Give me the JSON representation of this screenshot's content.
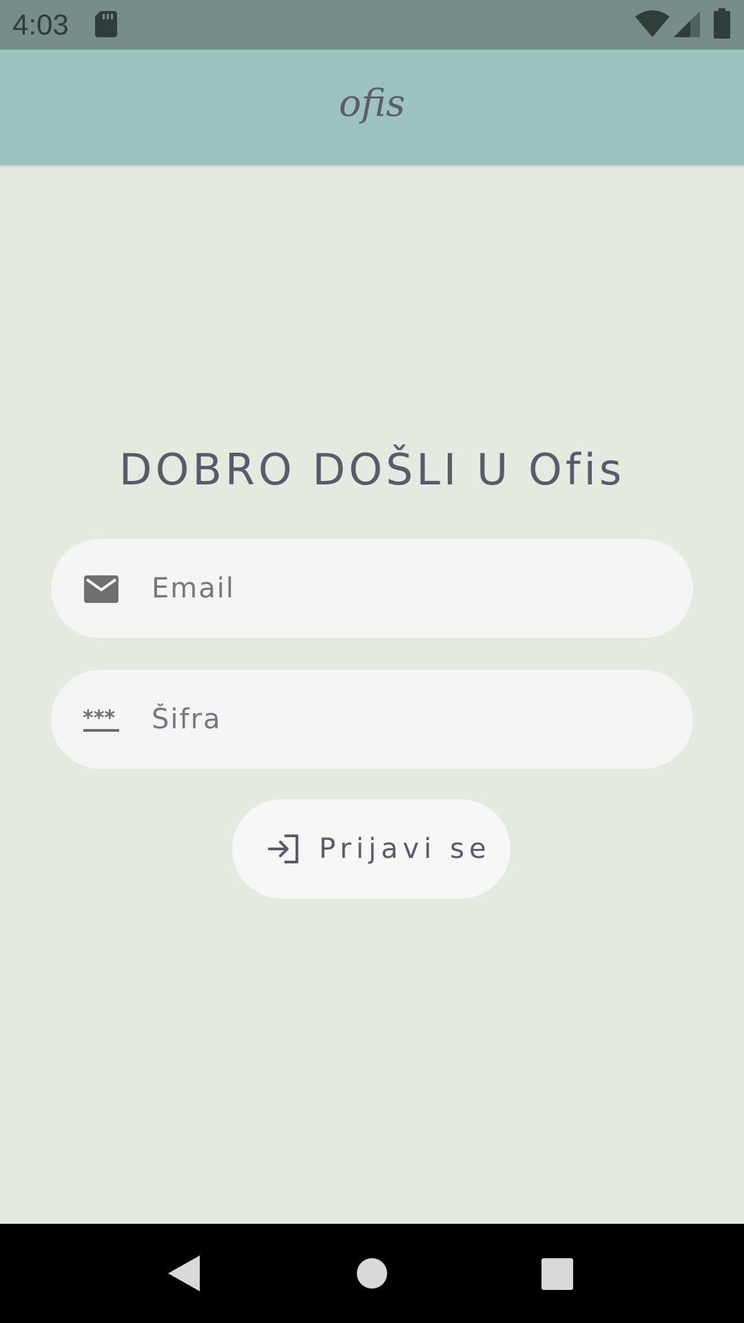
{
  "status_bar": {
    "time": "4:03",
    "icons": [
      "sd-card-icon",
      "wifi-icon",
      "cellular-signal-icon",
      "battery-icon"
    ]
  },
  "app_bar": {
    "title": "ofis"
  },
  "login": {
    "welcome": "DOBRO DOŠLI U Ofis",
    "email_placeholder": "Email",
    "email_value": "",
    "password_placeholder": "Šifra",
    "password_value": "",
    "submit_label": "Prijavi se",
    "email_icon": "email-icon",
    "password_icon": "password-icon",
    "submit_icon": "login-icon"
  },
  "navigation_bar": {
    "icons": [
      "back-icon",
      "home-icon",
      "recents-icon"
    ]
  },
  "colors": {
    "status_bar": "#778d89",
    "app_bar": "#9cc3be",
    "background": "#e5eae0",
    "field": "#f5f5f5",
    "text": "#5b5a6a",
    "icon": "#6f6f6f"
  }
}
